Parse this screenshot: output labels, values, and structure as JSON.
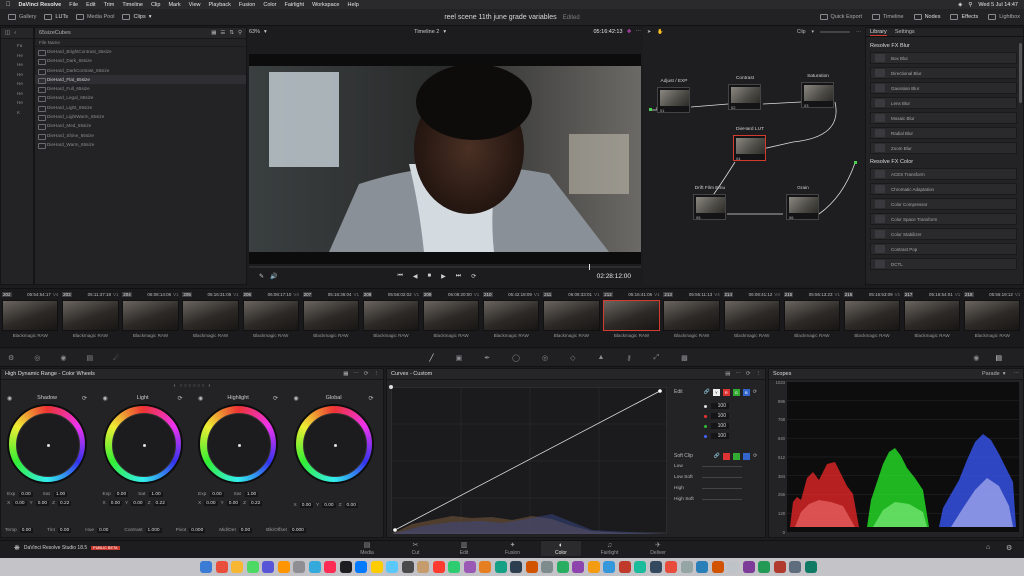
{
  "menubar": {
    "app": "DaVinci Resolve",
    "items": [
      "File",
      "Edit",
      "Trim",
      "Timeline",
      "Clip",
      "Mark",
      "View",
      "Playback",
      "Fusion",
      "Color",
      "Fairlight",
      "Workspace",
      "Help"
    ],
    "datetime": "Wed 5 Jul 14:47"
  },
  "toolbar": {
    "gallery": "Gallery",
    "luts": "LUTs",
    "media_pool": "Media Pool",
    "clips": "Clips",
    "project_title": "reel scene 11th june grade variables",
    "edited": "Edited",
    "quick_export": "Quick Export",
    "timeline": "Timeline",
    "nodes": "Nodes",
    "effects": "Effects",
    "lightbox": "Lightbox"
  },
  "viewerbar": {
    "zoom": "63%",
    "timeline_name": "Timeline 2",
    "timecode": "05:16:42:13",
    "clip_label": "Clip"
  },
  "lut_browser": {
    "folder": "65sizeCubes",
    "col_header": "File Name",
    "items": [
      "DieHard_BrightContrast_65size",
      "DieHard_Dark_65size",
      "DieHard_DarkContrast_65size",
      "DieHard_Flat_65size",
      "DieHard_Full_65size",
      "DieHard_Legal_65size",
      "DieHard_Light_65size",
      "DieHard_LightWarm_65size",
      "DieHard_Med_65size",
      "DieHard_Shine_65size",
      "DieHard_Warm_65size"
    ],
    "selected_index": 3,
    "side_letters": [
      "Fa",
      "He",
      "He",
      "He",
      "He",
      "He",
      "He",
      "K"
    ]
  },
  "transport": {
    "timecode": "02:28:12:00"
  },
  "nodes": [
    {
      "label": "Adjust / EXP",
      "num": "01"
    },
    {
      "label": "Contrast",
      "num": "02"
    },
    {
      "label": "Saturation",
      "num": "03"
    },
    {
      "label": "DieHard LUT",
      "num": "04"
    },
    {
      "label": "Drift Film Emu",
      "num": "05"
    },
    {
      "label": "Grain",
      "num": "06"
    }
  ],
  "library": {
    "tabs": [
      "Library",
      "Settings"
    ],
    "sections": [
      {
        "title": "Resolve FX Blur",
        "items": [
          "Box Blur",
          "Directional Blur",
          "Gaussian Blur",
          "Lens Blur",
          "Mosaic Blur",
          "Radial Blur",
          "Zoom Blur"
        ]
      },
      {
        "title": "Resolve FX Color",
        "items": [
          "ACES Transform",
          "Chromatic Adaptation",
          "Color Compressor",
          "Color Space Transform",
          "Color Stabilizer",
          "Contrast Pop",
          "DCTL"
        ]
      }
    ]
  },
  "clips": [
    {
      "n": "202",
      "tc": "05:54:54:17",
      "t": "V4"
    },
    {
      "n": "203",
      "tc": "05:11:37:18",
      "t": "V1"
    },
    {
      "n": "204",
      "tc": "06:08:14:06",
      "t": "V1"
    },
    {
      "n": "205",
      "tc": "05:16:31:06",
      "t": "V1"
    },
    {
      "n": "206",
      "tc": "06:08:17:10",
      "t": "V4"
    },
    {
      "n": "207",
      "tc": "05:16:36:04",
      "t": "V1"
    },
    {
      "n": "208",
      "tc": "05:56:02:02",
      "t": "V1"
    },
    {
      "n": "209",
      "tc": "06:08:20:00",
      "t": "V1"
    },
    {
      "n": "210",
      "tc": "05:42:18:09",
      "t": "V1"
    },
    {
      "n": "211",
      "tc": "06:08:33:01",
      "t": "V1"
    },
    {
      "n": "212",
      "tc": "05:16:41:06",
      "t": "V1"
    },
    {
      "n": "213",
      "tc": "05:56:11:13",
      "t": "V4"
    },
    {
      "n": "214",
      "tc": "06:08:41:12",
      "t": "V4"
    },
    {
      "n": "215",
      "tc": "05:56:13:23",
      "t": "V1"
    },
    {
      "n": "216",
      "tc": "05:16:53:09",
      "t": "V1"
    },
    {
      "n": "217",
      "tc": "05:16:54:01",
      "t": "V1"
    },
    {
      "n": "218",
      "tc": "05:56:19:12",
      "t": "V1"
    }
  ],
  "clip_label": "Blackmagic RAW",
  "selected_clip": 10,
  "wheels": {
    "title": "High Dynamic Range - Color Wheels",
    "items": [
      {
        "name": "Shadow",
        "exp": "0.00",
        "sat": "1.00",
        "x": "0.00",
        "y": "0.00",
        "z": "0.22"
      },
      {
        "name": "Light",
        "exp": "0.00",
        "sat": "1.00",
        "x": "0.00",
        "y": "0.00",
        "z": "0.22"
      },
      {
        "name": "Highlight",
        "exp": "0.00",
        "sat": "1.00",
        "x": "0.00",
        "y": "0.00",
        "z": "0.22"
      },
      {
        "name": "Global",
        "exp": "",
        "sat": "",
        "x": "0.00",
        "y": "0.00",
        "z": "0.00"
      }
    ],
    "bottom": [
      {
        "k": "Temp",
        "v": "0.00"
      },
      {
        "k": "Tint",
        "v": "0.00"
      },
      {
        "k": "Hue",
        "v": "0.00"
      },
      {
        "k": "Contrast",
        "v": "1.000"
      },
      {
        "k": "Pivot",
        "v": "0.000"
      },
      {
        "k": "Mid/Det",
        "v": "0.00"
      },
      {
        "k": "Blk/Offset",
        "v": "0.000"
      }
    ]
  },
  "curves": {
    "title": "Curves - Custom",
    "edit": "Edit",
    "values": [
      "100",
      "100",
      "100",
      "100"
    ],
    "soft_clip": "Soft Clip",
    "soft": [
      "Low",
      "Low Soft",
      "High",
      "High Soft"
    ]
  },
  "scopes": {
    "title": "Scopes",
    "mode": "Parade",
    "scale": [
      "1023",
      "896",
      "768",
      "640",
      "512",
      "384",
      "256",
      "128",
      "0"
    ]
  },
  "pages": [
    "Media",
    "Cut",
    "Edit",
    "Fusion",
    "Color",
    "Fairlight",
    "Deliver"
  ],
  "active_page": 4,
  "brand": {
    "name": "DaVinci Resolve Studio 18.5",
    "badge": "PUBLIC BETA"
  },
  "colors": {
    "accent": "#d23b2e",
    "wheel_shadow": "#e03030",
    "scope_r": "#ff3030",
    "scope_g": "#30ff30",
    "scope_b": "#4060ff"
  }
}
